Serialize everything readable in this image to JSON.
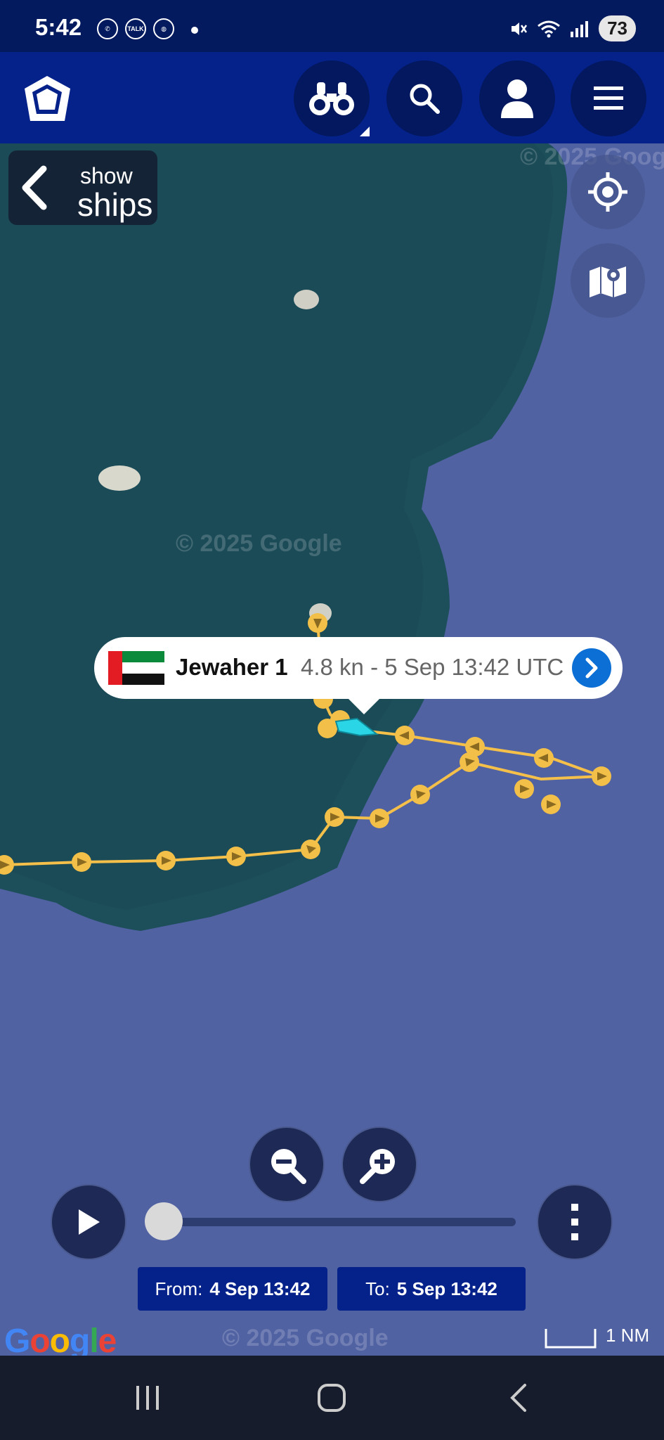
{
  "status_bar": {
    "time": "5:42",
    "notifications": [
      "whatsapp-icon",
      "talk-icon",
      "globe-icon"
    ],
    "talk_label": "TALK",
    "battery": "73"
  },
  "header": {
    "buttons": [
      "binoculars-icon",
      "search-icon",
      "profile-icon",
      "menu-icon"
    ]
  },
  "map": {
    "show_ships": {
      "line1": "show",
      "line2": "ships"
    },
    "watermark": "© 2025 Google",
    "popup": {
      "ship_name": "Jewaher 1",
      "info": "4.8 kn - 5 Sep 13:42 UTC",
      "flag": "uae-flag"
    },
    "playback": {
      "from_label": "From:",
      "from_value": "4 Sep 13:42",
      "to_label": "To:",
      "to_value": "5 Sep 13:42",
      "progress": 0
    },
    "attribution": "Google",
    "scale_label": "1 NM"
  },
  "colors": {
    "header": "#05228a",
    "status": "#031a5e",
    "track": "#f5c04a",
    "vessel": "#2ad6e6",
    "water": "#5162a3",
    "shallows": "#1d4f5a"
  }
}
